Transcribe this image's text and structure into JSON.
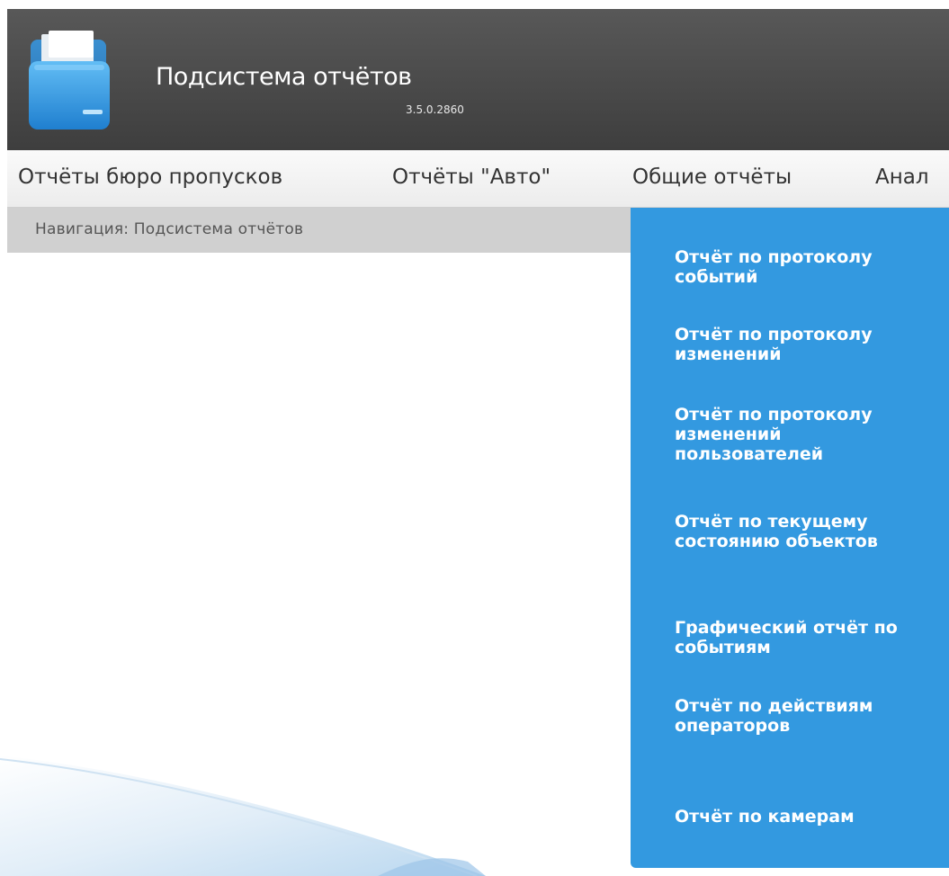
{
  "header": {
    "title": "Подсистема отчётов",
    "version": "3.5.0.2860",
    "logo_icon": "folder-icon"
  },
  "menu": {
    "items": [
      {
        "label": "Отчёты бюро пропусков"
      },
      {
        "label": "Отчёты \"Авто\""
      },
      {
        "label": "Общие отчёты"
      },
      {
        "label": "Анал"
      }
    ]
  },
  "breadcrumb": {
    "text": "Навигация: Подсистема отчётов"
  },
  "dropdown": {
    "items": [
      {
        "label": "Отчёт по протоколу событий"
      },
      {
        "label": "Отчёт по протоколу изменений"
      },
      {
        "label": "Отчёт по протоколу изменений пользователей"
      },
      {
        "label": "Отчёт по текущему состоянию объектов"
      },
      {
        "label": "Графический отчёт по событиям"
      },
      {
        "label": "Отчёт по действиям операторов"
      },
      {
        "label": "Отчёт по камерам"
      }
    ]
  },
  "colors": {
    "header_bg": "#4a4a4a",
    "menu_bg": "#f2f2f2",
    "breadcrumb_bg": "#d0d0d0",
    "dropdown_bg": "#3399e0",
    "folder_blue": "#3aa0e8"
  }
}
